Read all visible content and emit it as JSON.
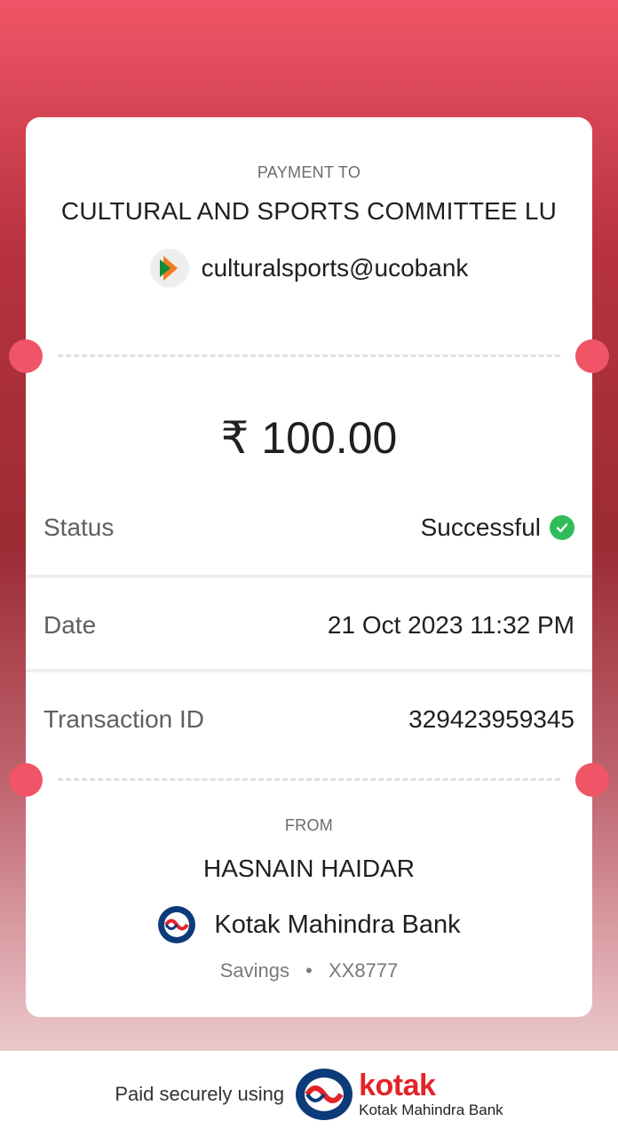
{
  "payment": {
    "to_label": "PAYMENT TO",
    "payee_name": "CULTURAL AND SPORTS COMMITTEE LU",
    "vpa": "culturalsports@ucobank",
    "amount": "₹ 100.00"
  },
  "details": {
    "status_label": "Status",
    "status_value": "Successful",
    "date_label": "Date",
    "date_value": "21 Oct 2023 11:32 PM",
    "txn_label": "Transaction ID",
    "txn_value": "329423959345"
  },
  "from": {
    "label": "FROM",
    "name": "HASNAIN HAIDAR",
    "bank": "Kotak Mahindra Bank",
    "account_type": "Savings",
    "separator": "•",
    "account_masked": "XX8777"
  },
  "footer": {
    "paid_text": "Paid securely using",
    "brand": "kotak",
    "brand_sub": "Kotak Mahindra Bank"
  },
  "colors": {
    "accent": "#ef5566",
    "success": "#2fbd5a",
    "kotak_red": "#e3232a",
    "kotak_blue": "#0d3b7a"
  },
  "icons": [
    "upi-icon",
    "check-circle-icon",
    "kotak-bank-icon",
    "kotak-logo-icon"
  ]
}
